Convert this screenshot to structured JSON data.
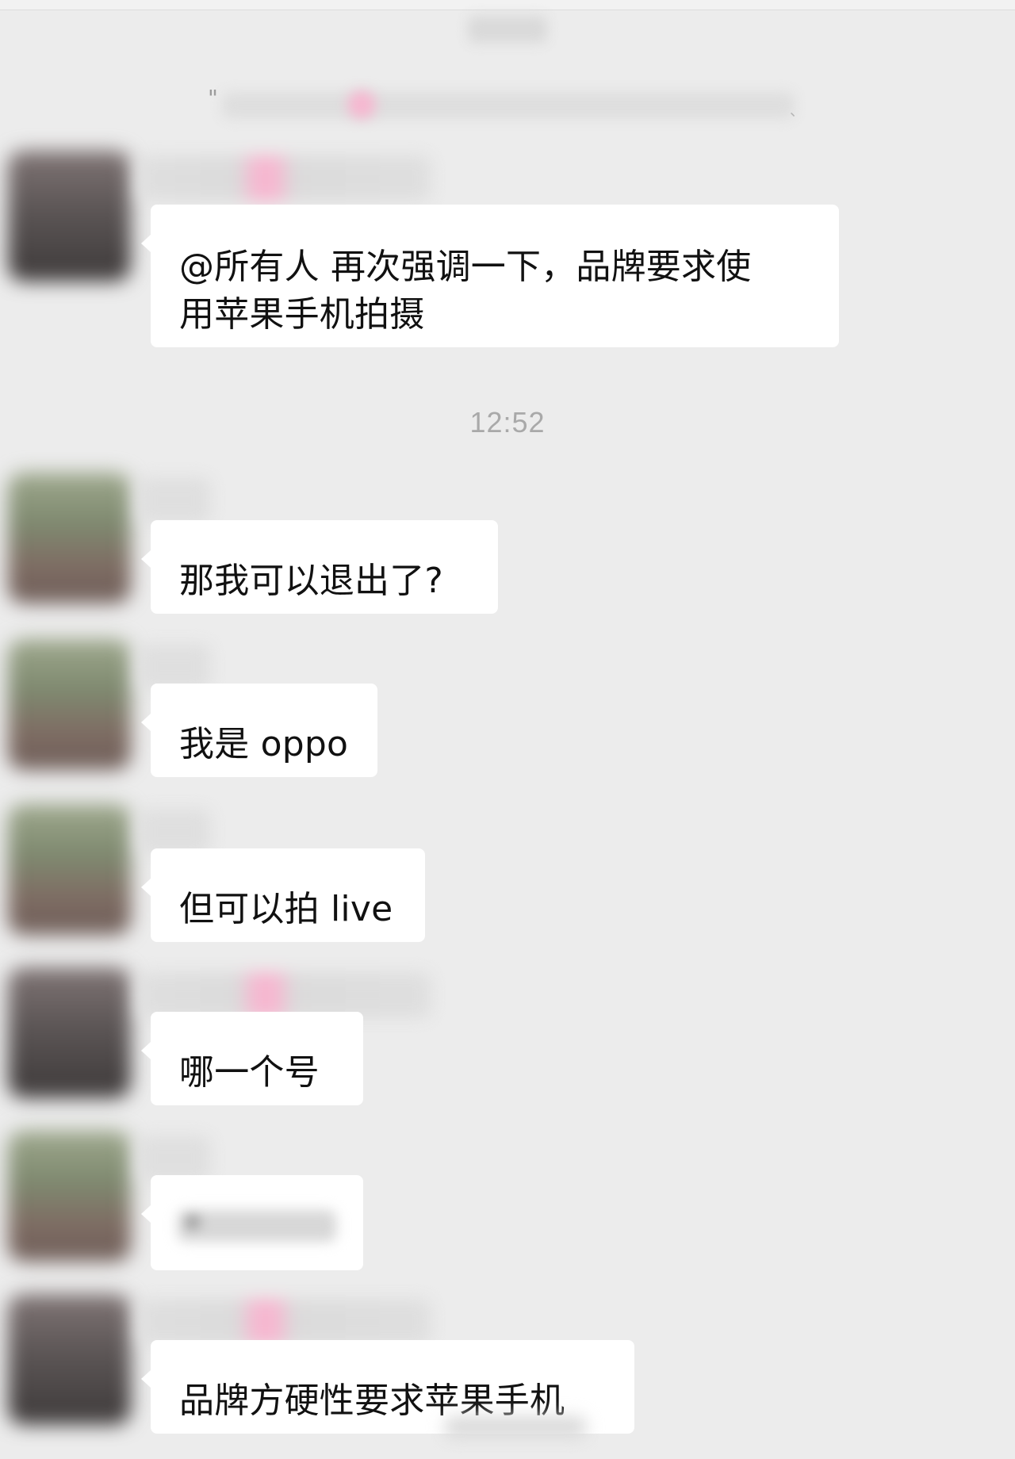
{
  "chat": {
    "timestamp": "12:52",
    "messages": [
      {
        "avatar_style": "dark",
        "sender_style": "long",
        "text": "@所有人 再次强调一下，品牌要求使\n用苹果手机拍摄"
      },
      {
        "avatar_style": "green",
        "sender_style": "short",
        "text": "那我可以退出了?"
      },
      {
        "avatar_style": "green",
        "sender_style": "short",
        "text": "我是 oppo"
      },
      {
        "avatar_style": "green",
        "sender_style": "short",
        "text": "但可以拍 live"
      },
      {
        "avatar_style": "dark",
        "sender_style": "long",
        "text": "哪一个号"
      },
      {
        "avatar_style": "green",
        "sender_style": "short",
        "text": ""
      },
      {
        "avatar_style": "dark",
        "sender_style": "long",
        "text": "品牌方硬性要求苹果手机"
      }
    ]
  }
}
